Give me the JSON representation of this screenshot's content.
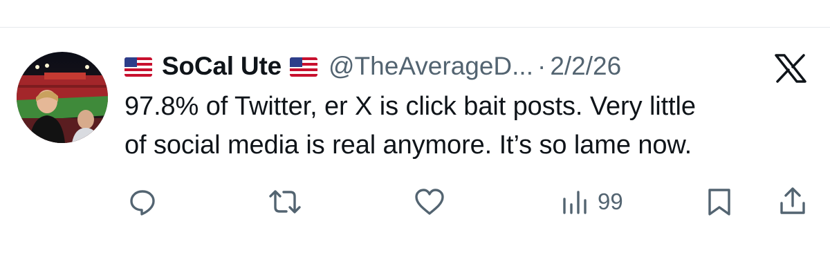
{
  "tweet": {
    "display_name": "SoCal Ute",
    "name_flag_icon": "us-flag-icon",
    "handle": "@TheAverageD...",
    "separator": "·",
    "date": "2/2/26",
    "text_line1": "97.8% of Twitter, er X is click bait posts. Very little",
    "text_line2": "of social media is real anymore. It’s so lame now."
  },
  "actions": {
    "reply_icon": "reply-icon",
    "retweet_icon": "retweet-icon",
    "like_icon": "heart-icon",
    "views_icon": "views-icon",
    "views_count": "99",
    "bookmark_icon": "bookmark-icon",
    "share_icon": "share-icon"
  },
  "brand": {
    "logo": "x-logo-icon",
    "text_color": "#0f1419",
    "muted_color": "#536471"
  }
}
